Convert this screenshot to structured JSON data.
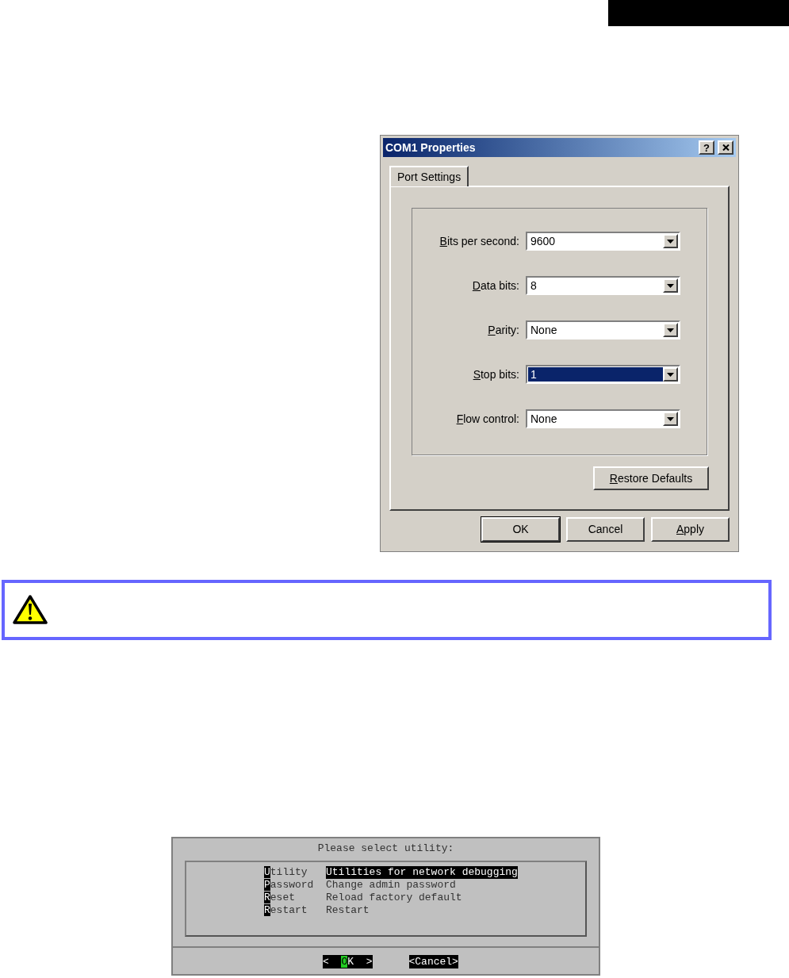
{
  "dialog": {
    "title": "COM1 Properties",
    "title_buttons": [
      {
        "kind": "help",
        "label": "?"
      },
      {
        "kind": "close"
      }
    ],
    "tabs": [
      {
        "label": "Port Settings",
        "selected": true
      }
    ],
    "fields": [
      {
        "accel": "B",
        "rest": "its per second:",
        "value": "9600",
        "focused": false
      },
      {
        "accel": "D",
        "rest": "ata bits:",
        "value": "8",
        "focused": false
      },
      {
        "accel": "P",
        "rest": "arity:",
        "value": "None",
        "focused": false
      },
      {
        "accel": "S",
        "rest": "top bits:",
        "value": "1",
        "focused": true
      },
      {
        "accel": "F",
        "rest": "low control:",
        "value": "None",
        "focused": false
      }
    ],
    "restore_button": {
      "accel": "R",
      "rest": "estore Defaults"
    },
    "buttons": [
      {
        "rest": "OK",
        "default": true
      },
      {
        "rest": "Cancel",
        "default": false
      },
      {
        "accel": "A",
        "rest": "pply",
        "default": false
      }
    ]
  },
  "warning": {
    "kind": "caution"
  },
  "terminal": {
    "title": "Please select utility:",
    "items": [
      {
        "key": "Utility",
        "description": "Utilities for network debugging",
        "selected": true
      },
      {
        "key": "Password",
        "description": "Change admin password",
        "selected": false
      },
      {
        "key": "Reset",
        "description": "Reload factory default",
        "selected": false
      },
      {
        "key": "Restart",
        "description": "Restart",
        "selected": false
      }
    ],
    "buttons": [
      {
        "parts": [
          {
            "text": "<  ",
            "cursor": false
          },
          {
            "text": "O",
            "cursor": true
          },
          {
            "text": "K  >",
            "cursor": false
          }
        ]
      },
      {
        "parts": [
          {
            "text": "<Cancel>",
            "cursor": false
          }
        ]
      }
    ]
  }
}
